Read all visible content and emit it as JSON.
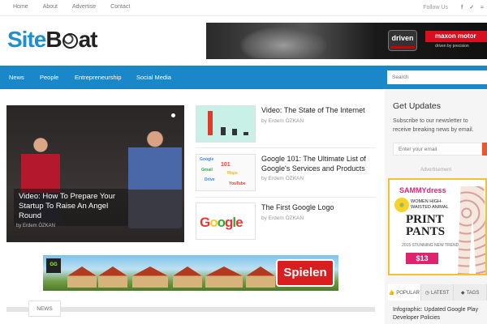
{
  "top_nav": [
    "Home",
    "About",
    "Advertise",
    "Contact"
  ],
  "follow": {
    "label": "Follow Us",
    "icons": [
      "facebook-icon",
      "twitter-icon",
      "rss-icon"
    ]
  },
  "logo": {
    "part1": "Site",
    "part2": "B",
    "part3": "at"
  },
  "top_ad": {
    "badge": "driven",
    "brand": "maxon motor",
    "tagline": "driven by precision"
  },
  "nav": {
    "items": [
      "News",
      "People",
      "Entrepreneurship",
      "Social Media"
    ],
    "search_placeholder": "Search"
  },
  "featured": {
    "title": "Video: How To Prepare Your Startup To Raise An Angel Round",
    "author": "by Erdem ÖZKAN"
  },
  "posts": [
    {
      "title": "Video: The State of The Internet",
      "author": "by Erdem ÖZKAN"
    },
    {
      "title": "Google 101: The Ultimate List of Google's Services and Products",
      "author": "by Erdem ÖZKAN"
    },
    {
      "title": "The First Google Logo",
      "author": "by Erdem ÖZKAN"
    }
  ],
  "game_ad": {
    "logo": "GG",
    "cta": "Spielen"
  },
  "news_tab": "NEWS",
  "sidebar": {
    "heading": "Get Updates",
    "text": "Subscribe to our newsletter to receive breaking news by email.",
    "email_placeholder": "Enter your email",
    "ad_label": "Advertisement",
    "ad": {
      "brand": "SAMMYdress",
      "sub": "WOMEN HIGH-WAISTED ANIMAL",
      "big": "PRINT PANTS",
      "trend": "2015 STUNNING NEW TREND",
      "price": "$13"
    },
    "tabs": [
      {
        "icon": "thumbs-up-icon",
        "label": "POPULAR"
      },
      {
        "icon": "clock-icon",
        "label": "LATEST"
      },
      {
        "icon": "tag-icon",
        "label": "TAGS"
      }
    ],
    "first_item": "Infographic: Updated Google Play Developer Policies"
  }
}
